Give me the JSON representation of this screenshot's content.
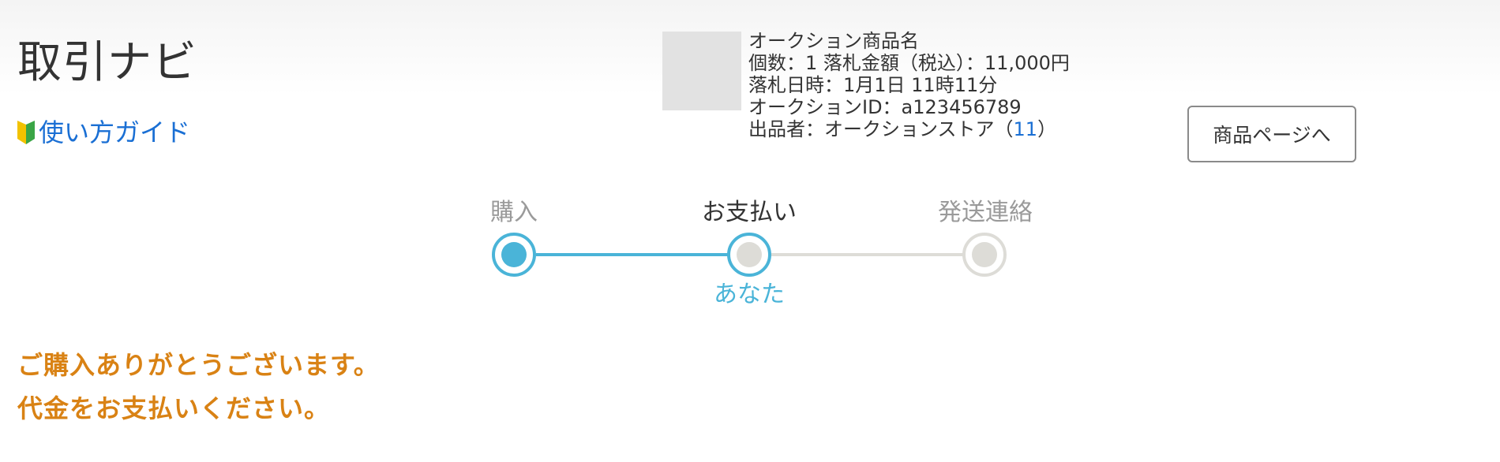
{
  "header": {
    "title": "取引ナビ",
    "guide_link": "使い方ガイド"
  },
  "item": {
    "name": "オークション商品名",
    "quantity_price": "個数：1 落札金額（税込）：11,000円",
    "won_date": "落札日時：1月1日 11時11分",
    "auction_id": "オークションID：a123456789",
    "seller_prefix": "出品者：オークションストア（",
    "seller_count": "11",
    "seller_suffix": "）",
    "product_button": "商品ページへ"
  },
  "stepper": {
    "steps": [
      {
        "label": "購入",
        "state": "done"
      },
      {
        "label": "お支払い",
        "state": "current",
        "sub_label": "あなた"
      },
      {
        "label": "発送連絡",
        "state": "todo"
      }
    ]
  },
  "message": {
    "line1": "ご購入ありがとうございます。",
    "line2": "代金をお支払いください。"
  },
  "colors": {
    "accent": "#4ab4d8",
    "link": "#1a6fd4",
    "message": "#d98214",
    "inactive": "#dddcd7"
  },
  "icons": {
    "guide": "beginner-mark-icon"
  }
}
